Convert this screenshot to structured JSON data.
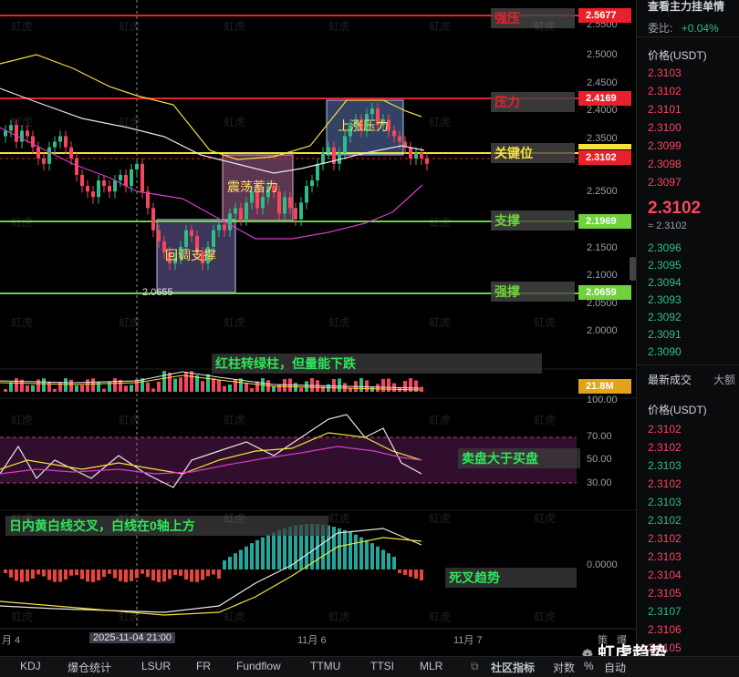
{
  "sidebar": {
    "top_title": "查看主力挂单情",
    "change_label": "委比:",
    "change_value": "+0.04%",
    "price_header": "价格(USDT)",
    "asks": [
      "2.3103",
      "2.3102",
      "2.3101",
      "2.3100",
      "2.3099",
      "2.3098",
      "2.3097"
    ],
    "mid_price": "2.3102",
    "mid_sub": "≈ 2.3102",
    "bids": [
      "2.3096",
      "2.3095",
      "2.3094",
      "2.3093",
      "2.3092",
      "2.3091",
      "2.3090"
    ],
    "trades_title": "最新成交",
    "trades_tab2": "大额",
    "trades_header": "价格(USDT)",
    "trades": [
      {
        "p": "2.3102",
        "c": "red"
      },
      {
        "p": "2.3102",
        "c": "red"
      },
      {
        "p": "2.3103",
        "c": "green"
      },
      {
        "p": "2.3102",
        "c": "red"
      },
      {
        "p": "2.3103",
        "c": "green"
      },
      {
        "p": "2.3102",
        "c": "green"
      },
      {
        "p": "2.3102",
        "c": "red"
      },
      {
        "p": "2.3103",
        "c": "red"
      },
      {
        "p": "2.3104",
        "c": "red"
      },
      {
        "p": "2.3105",
        "c": "red"
      },
      {
        "p": "2.3107",
        "c": "green"
      },
      {
        "p": "2.3106",
        "c": "red"
      },
      {
        "p": "2.3105",
        "c": "red"
      }
    ]
  },
  "price_axis": [
    "2.5500",
    "2.5000",
    "2.4500",
    "2.4000",
    "2.3500",
    "2.2500",
    "2.2000",
    "2.1500",
    "2.1000",
    "2.0500",
    "2.0000"
  ],
  "levels": {
    "strong_resistance": {
      "name": "强压",
      "value": "2.5677",
      "color": "#e8212c"
    },
    "resistance": {
      "name": "压力",
      "value": "2.4169",
      "color": "#e8212c"
    },
    "key": {
      "name": "关键位",
      "value": "2.3102",
      "color": "#f5e13a"
    },
    "support": {
      "name": "支撑",
      "value": "2.1969",
      "color": "#6fd23a"
    },
    "strong_support": {
      "name": "强撑",
      "value": "2.0659",
      "color": "#6fd23a"
    }
  },
  "current_price_tag": "2.3102",
  "low_marker": "2.0655",
  "boxes": {
    "pullback": "回调支撑",
    "consolidation": "震荡蓄力",
    "rally": "上涨压力"
  },
  "volume": {
    "annotation": "红柱转绿柱，但量能下跌",
    "tag": "21.8M"
  },
  "kdj": {
    "annotation": "卖盘大于买盘",
    "ticks": [
      "100.00",
      "70.00",
      "50.00",
      "30.00"
    ]
  },
  "macd": {
    "annotation": "日内黄白线交叉，白线在0轴上方",
    "annotation2": "死叉趋势",
    "tick": "0.0000"
  },
  "time_axis": {
    "ticks": [
      "月 4",
      "11月 6",
      "11月 7"
    ],
    "crosshair_label": "2025-11-04 21:00"
  },
  "bottom_tabs": [
    "KDJ",
    "爆仓统计",
    "LSUR",
    "FR",
    "Fundflow",
    "TTMU",
    "TTSI",
    "MLR"
  ],
  "bottom_right": {
    "community": "社区指标",
    "pair": "对数",
    "pct": "%",
    "auto": "自动"
  },
  "corner_top": "策",
  "corner_top2": "爆",
  "brand": "虹虎趋势",
  "watermark": "虹虎",
  "colors": {
    "up": "#2ebd85",
    "down": "#f6465d",
    "yellow": "#f5e13a",
    "white": "#e6e6e6",
    "pink": "#d63cc8"
  }
}
